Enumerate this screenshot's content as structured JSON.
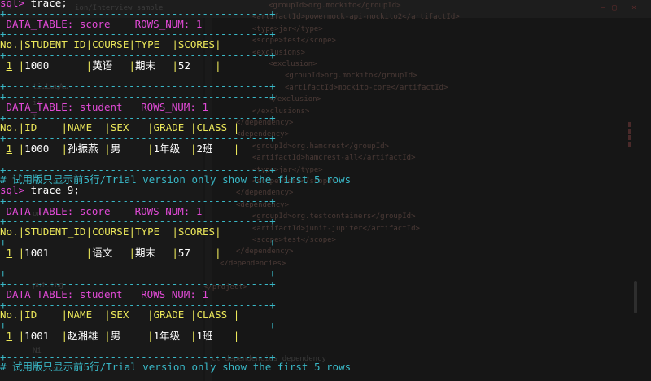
{
  "background_editor": {
    "path_text": "ion/Interview_sample",
    "sidebar_lines": [
      "ti…LogA…",
      "ir",
      "I",
      "on",
      "put.log",
      "Ni"
    ],
    "code_lines": [
      {
        "text": "<groupId>org.mockito</groupId>",
        "kind": "tag"
      },
      {
        "text": "<artifactId>powermock-api-mockito2</artifactId>",
        "kind": "tag"
      },
      {
        "text": "<type>jar</type>",
        "kind": "tag"
      },
      {
        "text": "<scope>test</scope>",
        "kind": "tag"
      },
      {
        "text": "<exclusions>",
        "kind": "tag"
      },
      {
        "text": "<exclusion>",
        "kind": "tag"
      },
      {
        "text": "<groupId>org.mockito</groupId>",
        "kind": "tag"
      },
      {
        "text": "<artifactId>mockito-core</artifactId>",
        "kind": "tag"
      },
      {
        "text": "</exclusion>",
        "kind": "tag"
      },
      {
        "text": "</exclusions>",
        "kind": "tag"
      },
      {
        "text": "</dependency>",
        "kind": "tag"
      },
      {
        "text": "<dependency>",
        "kind": "tag"
      },
      {
        "text": "<groupId>org.hamcrest</groupId>",
        "kind": "tag"
      },
      {
        "text": "<artifactId>hamcrest-all</artifactId>",
        "kind": "tag"
      },
      {
        "text": "<type>jar</type>",
        "kind": "tag"
      },
      {
        "text": "<scope>test</scope>",
        "kind": "tag"
      },
      {
        "text": "</dependency>",
        "kind": "tag"
      },
      {
        "text": "<dependency>",
        "kind": "tag"
      },
      {
        "text": "<groupId>org.testcontainers</groupId>",
        "kind": "tag"
      },
      {
        "text": "<artifactId>junit-jupiter</artifactId>",
        "kind": "tag"
      },
      {
        "text": "<scope>test</scope>",
        "kind": "tag"
      },
      {
        "text": "</dependency>",
        "kind": "tag"
      },
      {
        "text": "</dependencies>",
        "kind": "tag"
      },
      {
        "text": "",
        "kind": "tag"
      },
      {
        "text": "</project>",
        "kind": "tag"
      }
    ],
    "bottom_tabs": "ct    dependencies    dependency"
  },
  "terminal": {
    "prompt": "sql>",
    "commands": [
      "trace;",
      "trace 9;"
    ],
    "border_line": "+-------------------------------------------+",
    "data_table_label": "DATA_TABLE:",
    "rows_num_label": "ROWS_NUM:",
    "footer_note": "# 试用版只显示前5行/Trial version only show the first 5 rows",
    "blocks": [
      {
        "command": "trace;",
        "tables": [
          {
            "name": "score",
            "rows_num": "1",
            "header": [
              "No.",
              "STUDENT_ID",
              "COURSE",
              "TYPE",
              "SCORES"
            ],
            "rows": [
              [
                "1",
                "1000",
                "英语",
                "期末",
                "52"
              ]
            ]
          },
          {
            "name": "student",
            "rows_num": "1",
            "header": [
              "No.",
              "ID",
              "NAME",
              "SEX",
              "GRADE",
              "CLASS"
            ],
            "rows": [
              [
                "1",
                "1000",
                "孙振燕",
                "男",
                "1年级",
                "2班"
              ]
            ]
          }
        ]
      },
      {
        "command": "trace 9;",
        "tables": [
          {
            "name": "score",
            "rows_num": "1",
            "header": [
              "No.",
              "STUDENT_ID",
              "COURSE",
              "TYPE",
              "SCORES"
            ],
            "rows": [
              [
                "1",
                "1001",
                "语文",
                "期末",
                "57"
              ]
            ]
          },
          {
            "name": "student",
            "rows_num": "1",
            "header": [
              "No.",
              "ID",
              "NAME",
              "SEX",
              "GRADE",
              "CLASS"
            ],
            "rows": [
              [
                "1",
                "1001",
                "赵湘雄",
                "男",
                "1年级",
                "1班"
              ]
            ]
          }
        ]
      }
    ]
  },
  "colors": {
    "background": "#161616",
    "prompt": "#e14ad6",
    "border": "#39b8c7",
    "header": "#ece85a",
    "text": "#ffffff"
  }
}
